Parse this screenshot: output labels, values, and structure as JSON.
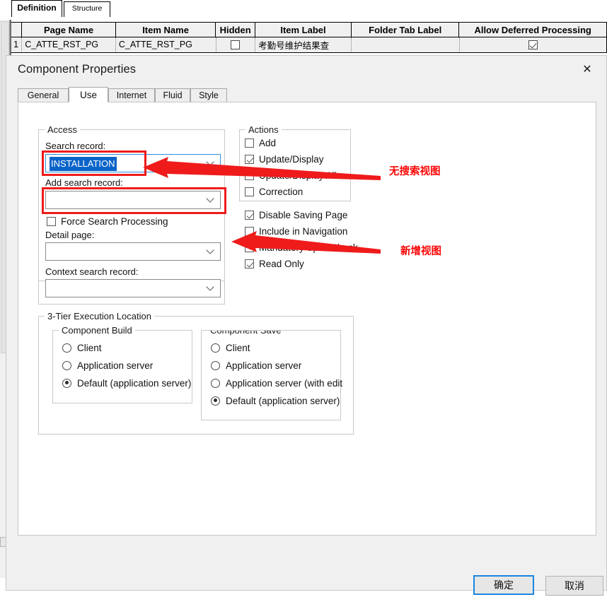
{
  "background": {
    "tabs": [
      {
        "label": "Definition",
        "active": true
      },
      {
        "label": "Structure",
        "active": false
      }
    ],
    "grid": {
      "columns": [
        "",
        "Page Name",
        "Item Name",
        "Hidden",
        "Item Label",
        "Folder Tab Label",
        "Allow Deferred Processing"
      ],
      "rows": [
        {
          "index": "1",
          "page_name": "C_ATTE_RST_PG",
          "item_name": "C_ATTE_RST_PG",
          "hidden": false,
          "item_label": "考勤号维护结果查",
          "folder_tab_label": "",
          "allow_deferred_processing": true
        }
      ]
    }
  },
  "dialog": {
    "title": "Component Properties",
    "close_label": "✕",
    "tabs": [
      {
        "label": "General",
        "selected": false
      },
      {
        "label": "Use",
        "selected": true
      },
      {
        "label": "Internet",
        "selected": false
      },
      {
        "label": "Fluid",
        "selected": false
      },
      {
        "label": "Style",
        "selected": false
      }
    ],
    "access": {
      "legend": "Access",
      "search_record_label": "Search record:",
      "search_record_value": "INSTALLATION",
      "add_search_record_label": "Add search record:",
      "add_search_record_value": "",
      "force_search_processing_label": "Force Search Processing",
      "force_search_processing_checked": false,
      "detail_page_label": "Detail page:",
      "detail_page_value": "",
      "context_search_record_label": "Context search record:",
      "context_search_record_value": ""
    },
    "actions": {
      "legend": "Actions",
      "items": [
        {
          "label": "Add",
          "checked": false
        },
        {
          "label": "Update/Display",
          "checked": true
        },
        {
          "label": "Update/Display All",
          "checked": false
        },
        {
          "label": "Correction",
          "checked": false
        }
      ]
    },
    "options": [
      {
        "label": "Disable Saving Page",
        "checked": true
      },
      {
        "label": "Include in Navigation",
        "checked": false
      },
      {
        "label": "Mandatory Spell Check",
        "checked": false
      },
      {
        "label": "Read Only",
        "checked": true
      }
    ],
    "three_tier": {
      "legend": "3-Tier Execution Location",
      "component_build": {
        "legend": "Component Build",
        "options": [
          {
            "label": "Client",
            "selected": false
          },
          {
            "label": "Application server",
            "selected": false
          },
          {
            "label": "Default (application server)",
            "selected": true
          }
        ]
      },
      "component_save": {
        "legend": "Component Save",
        "options": [
          {
            "label": "Client",
            "selected": false
          },
          {
            "label": "Application server",
            "selected": false
          },
          {
            "label": "Application server (with edits",
            "selected": false
          },
          {
            "label": "Default (application server)",
            "selected": true
          }
        ]
      }
    },
    "annotations": [
      {
        "text": "无搜索视图"
      },
      {
        "text": "新增视图"
      }
    ],
    "footer": {
      "ok_label": "确定",
      "cancel_label": "取消"
    }
  },
  "colors": {
    "annotation_red": "#fb0505",
    "highlight_blue": "#0a64c8",
    "focus_blue": "#2a8fe0",
    "dialog_bg": "#f0f0f0",
    "panel_bg": "#ffffff"
  }
}
